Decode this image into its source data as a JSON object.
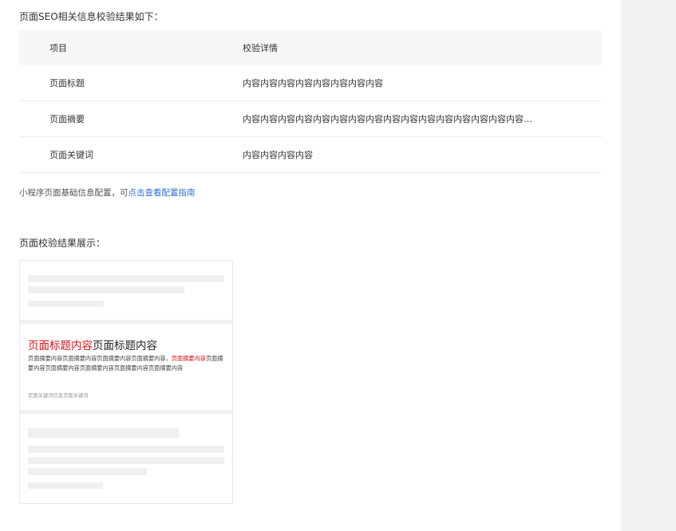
{
  "seo": {
    "heading": "页面SEO相关信息校验结果如下：",
    "columns": {
      "item": "项目",
      "detail": "校验详情"
    },
    "rows": [
      {
        "item": "页面标题",
        "detail": "内容内容内容内容内容内容内容内容"
      },
      {
        "item": "页面摘要",
        "detail": "内容内容内容内容内容内容内容内容内容内容内容内容内容内容内容内容…"
      },
      {
        "item": "页面关键词",
        "detail": "内容内容内容内容"
      }
    ]
  },
  "config": {
    "text": "小程序页面基础信息配置，可",
    "link": "点击查看配置指南"
  },
  "preview": {
    "heading": "页面校验结果展示：",
    "title_highlight": "页面标题内容",
    "title_rest": "页面标题内容",
    "summary_part1": "页面摘要内容页面摘要内容页面摘要内容页面摘要内容，",
    "summary_highlight": "页面摘要内容",
    "summary_part2": "页面摘要内容页面摘要内容页面摘要内容页面摘要内容页面摘要内容",
    "keywords": "页面关键词信息页面关键词"
  },
  "colors": {
    "highlight": "#d2141a",
    "link": "#2f6fd6",
    "table_header_bg": "#f7f7f7",
    "right_panel_bg": "#f3f3f3"
  }
}
